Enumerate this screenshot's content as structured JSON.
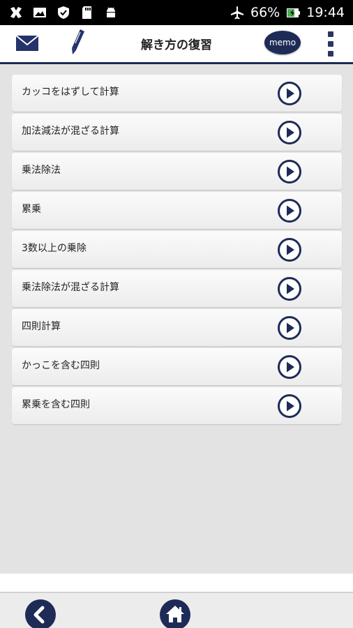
{
  "status_bar": {
    "battery": "66%",
    "time": "19:44",
    "icons": [
      "app-icon",
      "image-icon",
      "shield-icon",
      "sd-card-icon",
      "android-icon",
      "airplane-mode-icon",
      "battery-charging-icon"
    ]
  },
  "header": {
    "title": "解き方の復習",
    "memo_label": "memo",
    "icons": [
      "mail-icon",
      "pencil-icon",
      "overflow-menu-icon"
    ],
    "accent_color": "#1c2a55"
  },
  "list": {
    "items": [
      {
        "label": "カッコをはずして計算"
      },
      {
        "label": "加法減法が混ざる計算"
      },
      {
        "label": "乗法除法"
      },
      {
        "label": "累乗"
      },
      {
        "label": "3数以上の乗除"
      },
      {
        "label": "乗法除法が混ざる計算"
      },
      {
        "label": "四則計算"
      },
      {
        "label": "かっこを含む四則"
      },
      {
        "label": "累乗を含む四則"
      }
    ],
    "item_icon": "play-icon"
  },
  "bottom_nav": {
    "icons": [
      "back-icon",
      "home-icon"
    ],
    "button_color": "#1f2b57"
  }
}
